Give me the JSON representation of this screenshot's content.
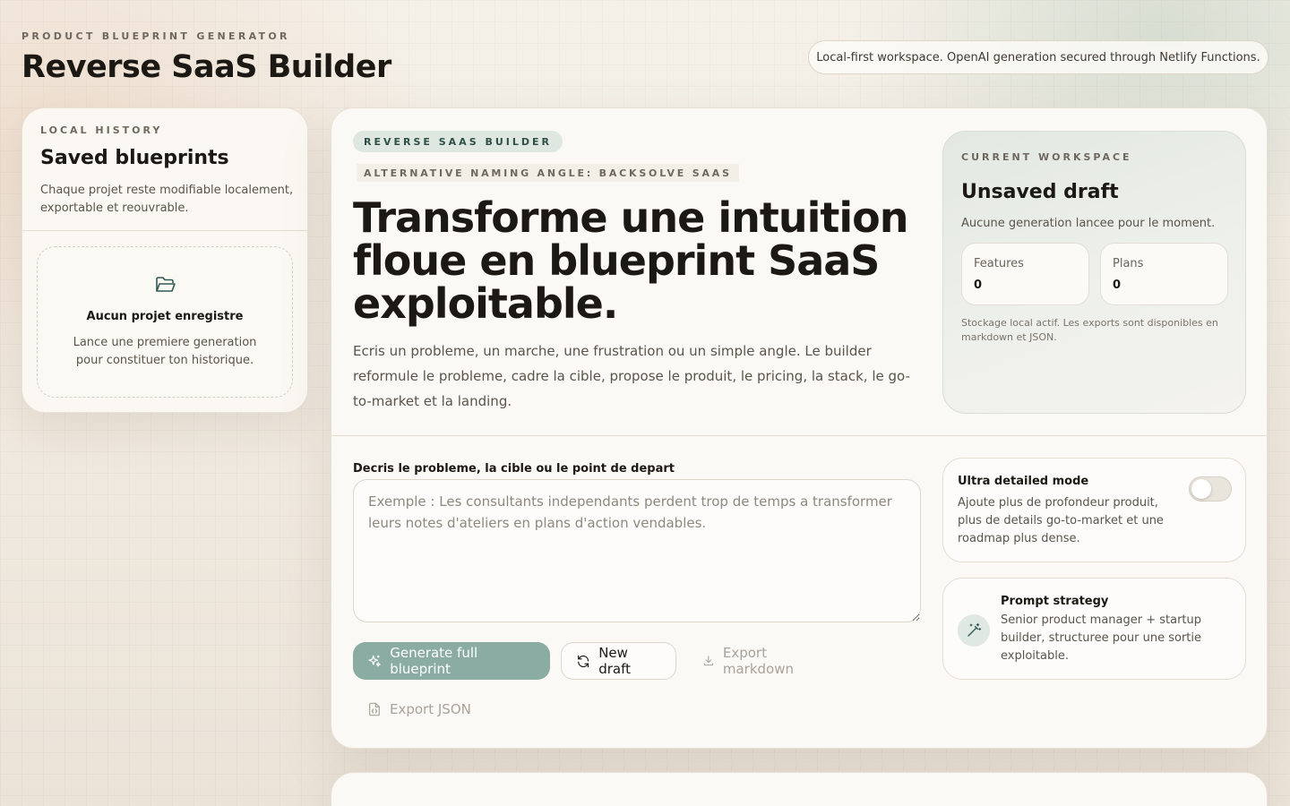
{
  "header": {
    "eyebrow": "PRODUCT BLUEPRINT GENERATOR",
    "title": "Reverse SaaS Builder",
    "info_pill": "Local-first workspace. OpenAI generation secured through Netlify Functions."
  },
  "sidebar": {
    "kicker": "LOCAL HISTORY",
    "title": "Saved blueprints",
    "description": "Chaque projet reste modifiable localement, exportable et reouvrable.",
    "empty_icon": "folder-open-icon",
    "empty_title": "Aucun projet enregistre",
    "empty_description": "Lance une premiere generation pour constituer ton historique."
  },
  "main": {
    "badge": "REVERSE SAAS BUILDER",
    "alt_angle": "ALTERNATIVE NAMING ANGLE: BACKSOLVE SAAS",
    "hero": "Transforme une intuition floue en blueprint SaaS exploitable.",
    "intro": "Ecris un probleme, un marche, une frustration ou un simple angle. Le builder reformule le probleme, cadre la cible, propose le produit, le pricing, la stack, le go-to-market et la landing.",
    "workspace": {
      "kicker": "CURRENT WORKSPACE",
      "title": "Unsaved draft",
      "subtitle": "Aucune generation lancee pour le moment.",
      "stats": [
        {
          "label": "Features",
          "value": "0"
        },
        {
          "label": "Plans",
          "value": "0"
        }
      ],
      "note": "Stockage local actif. Les exports sont disponibles en markdown et JSON."
    },
    "input": {
      "label": "Decris le probleme, la cible ou le point de depart",
      "placeholder": "Exemple : Les consultants independants perdent trop de temps a transformer leurs notes d'ateliers en plans d'action vendables.",
      "value": ""
    },
    "actions": {
      "generate": "Generate full blueprint",
      "new_draft": "New draft",
      "export_markdown": "Export markdown",
      "export_json": "Export JSON"
    },
    "ultra_mode": {
      "title": "Ultra detailed mode",
      "description": "Ajoute plus de profondeur produit, plus de details go-to-market et une roadmap plus dense.",
      "enabled": false
    },
    "prompt_strategy": {
      "icon": "magic-wand-icon",
      "title": "Prompt strategy",
      "description": "Senior product manager + startup builder, structuree pour une sortie exploitable."
    }
  },
  "colors": {
    "accent": "#8aaca2",
    "badge_bg": "#dfe7e1",
    "icon_accent": "#2f5a52"
  }
}
